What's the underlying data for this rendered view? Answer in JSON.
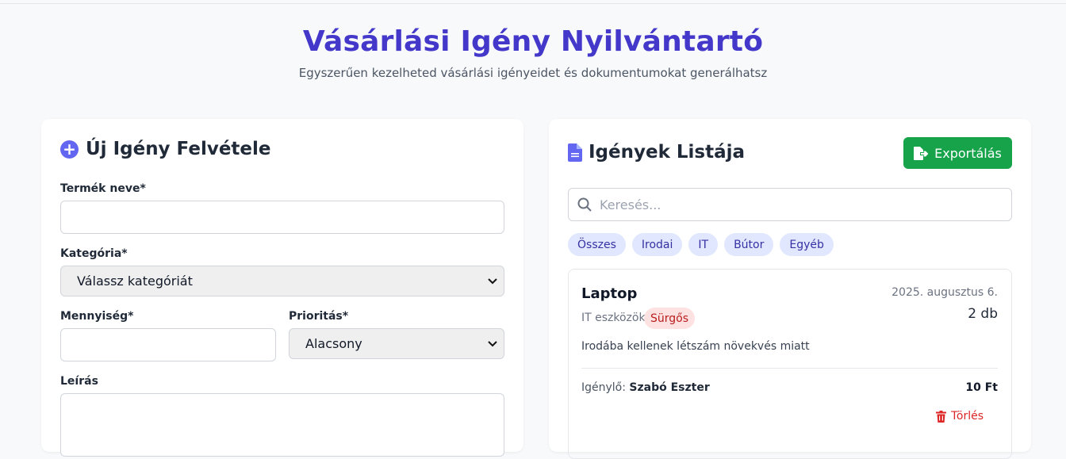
{
  "header": {
    "title": "Vásárlási Igény Nyilvántartó",
    "subtitle": "Egyszerűen kezelheted vásárlási igényeidet és dokumentumokat generálhatsz"
  },
  "form": {
    "title": "Új Igény Felvétele",
    "product_label": "Termék neve*",
    "product_value": "",
    "category_label": "Kategória*",
    "category_selected": "Válassz kategóriát",
    "quantity_label": "Mennyiség*",
    "quantity_value": "",
    "priority_label": "Prioritás*",
    "priority_selected": "Alacsony",
    "description_label": "Leírás",
    "description_value": ""
  },
  "list": {
    "title": "Igények Listája",
    "export_label": "Exportálás",
    "search_placeholder": "Keresés...",
    "filters": [
      "Összes",
      "Irodai",
      "IT",
      "Bútor",
      "Egyéb"
    ],
    "items": [
      {
        "name": "Laptop",
        "date": "2025. augusztus 6.",
        "category": "IT eszközök",
        "priority": "Sürgős",
        "quantity": "2 db",
        "description": "Irodába kellenek létszám növekvés miatt",
        "requester_label": "Igénylő:",
        "requester": "Szabó Eszter",
        "price": "10 Ft",
        "delete_label": "Törlés"
      }
    ]
  },
  "colors": {
    "accent": "#4338ca",
    "export_green": "#16a34a",
    "delete_red": "#dc2626",
    "chip_bg": "#e0e7ff"
  }
}
